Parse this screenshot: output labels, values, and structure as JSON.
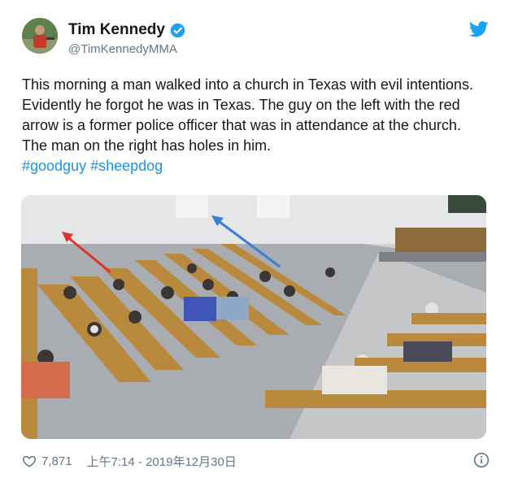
{
  "author": {
    "name": "Tim Kennedy",
    "handle": "@TimKennedyMMA"
  },
  "tweet": {
    "text": "This morning a man walked into a church in Texas with evil intentions. Evidently he forgot he was in Texas. The guy on the left with the red arrow is a former police officer that was in attendance at the church. The man on the right has holes in him.",
    "hashtags": "#goodguy #sheepdog"
  },
  "footer": {
    "likes": "7,871",
    "timestamp": "上午7:14 - 2019年12月30日"
  },
  "colors": {
    "link": "#1b95e0",
    "verified": "#1da1f2",
    "twitter_bird": "#1da1f2",
    "arrow_left": "#e0322b",
    "arrow_right": "#3a7fd8"
  },
  "icons": [
    "verified-badge-icon",
    "twitter-bird-icon",
    "heart-icon",
    "info-icon"
  ]
}
